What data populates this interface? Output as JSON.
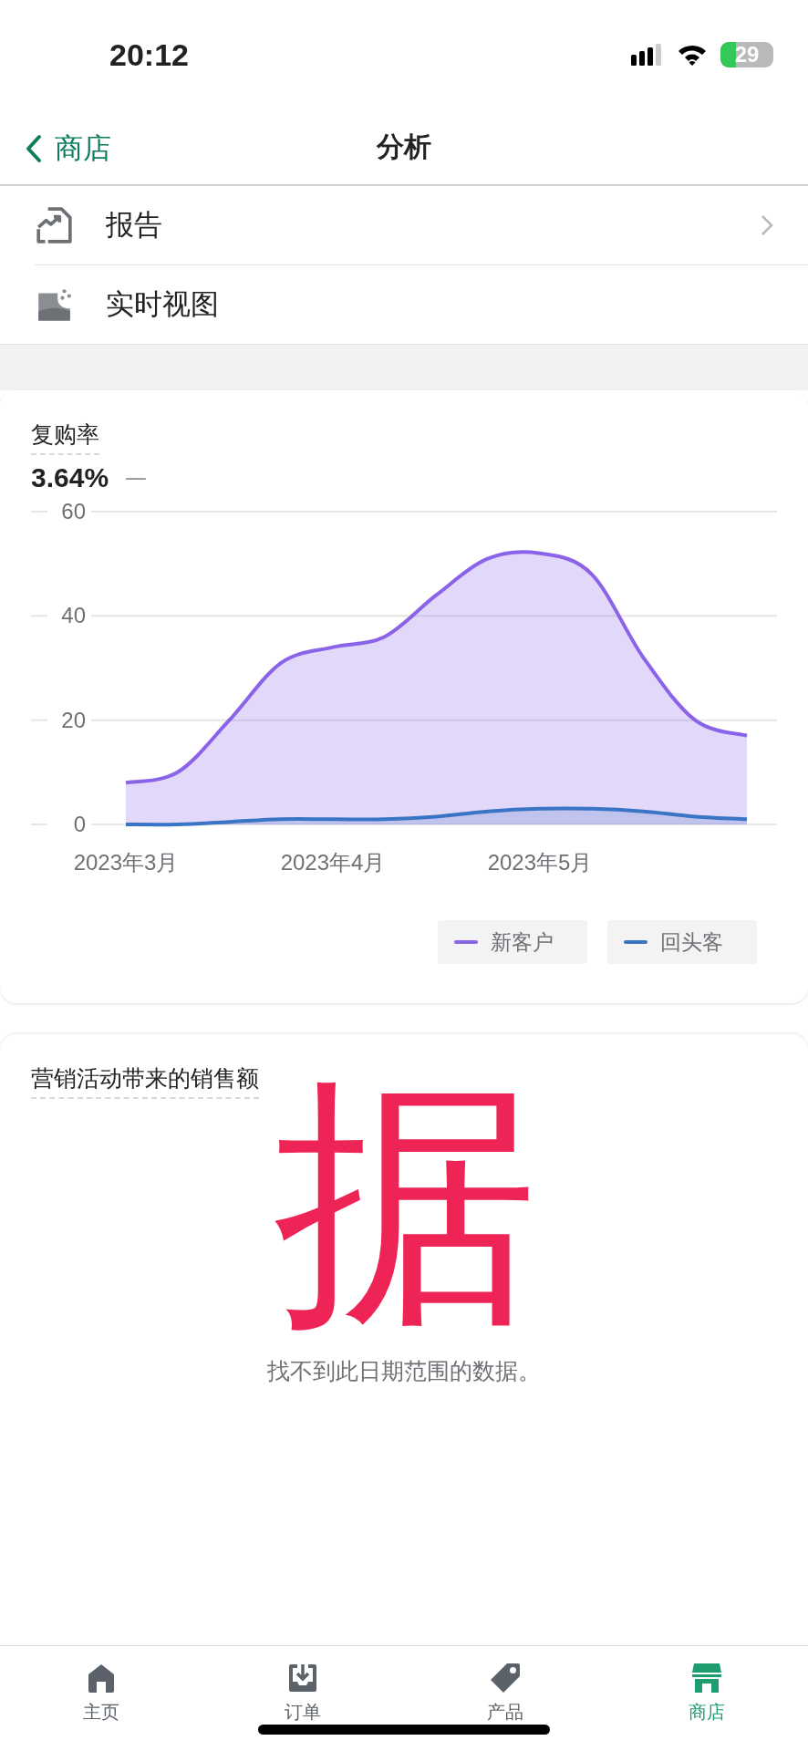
{
  "status_bar": {
    "time": "20:12",
    "battery": "29"
  },
  "nav": {
    "back": "商店",
    "title": "分析"
  },
  "menu": [
    {
      "kind": "report",
      "label": "报告",
      "chevron": true
    },
    {
      "kind": "live",
      "label": "实时视图",
      "chevron": false
    }
  ],
  "repeat_card": {
    "title": "复购率",
    "value": "3.64%",
    "change": "—",
    "chart_data": {
      "type": "area",
      "categories": [
        "2023年3月",
        null,
        null,
        null,
        "2023年4月",
        null,
        null,
        null,
        "2023年5月",
        null,
        null,
        null,
        null
      ],
      "ylim": [
        0,
        60
      ],
      "yticks": [
        0,
        20,
        40,
        60
      ],
      "series": [
        {
          "name": "新客户",
          "color": "#8b63e8",
          "values": [
            8,
            10,
            20,
            31,
            34,
            36,
            44,
            51,
            52,
            48,
            32,
            20,
            17
          ]
        },
        {
          "name": "回头客",
          "color": "#3a74c4",
          "values": [
            0,
            0,
            0.5,
            1,
            1,
            1,
            1.5,
            2.5,
            3,
            3,
            2.5,
            1.5,
            1
          ]
        }
      ]
    }
  },
  "marketing_card": {
    "title": "营销活动带来的销售额",
    "empty_message": "找不到此日期范围的数据。"
  },
  "annotation": "据",
  "tab_bar": [
    {
      "kind": "home",
      "label": "主页",
      "selected": false
    },
    {
      "kind": "orders",
      "label": "订单",
      "selected": false
    },
    {
      "kind": "products",
      "label": "产品",
      "selected": false
    },
    {
      "kind": "store",
      "label": "商店",
      "selected": true
    }
  ]
}
